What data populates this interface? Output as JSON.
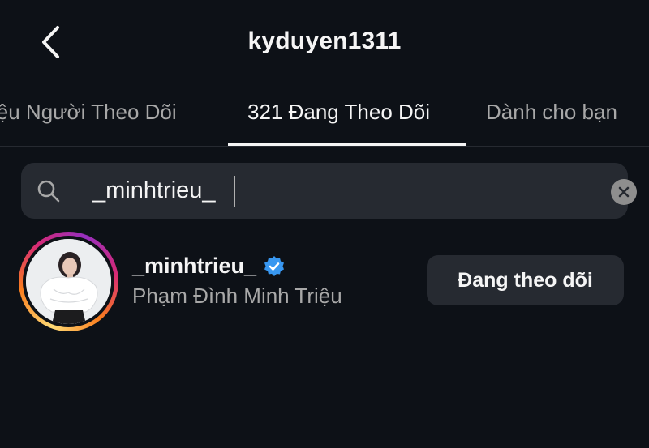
{
  "header": {
    "title": "kyduyen1311",
    "back_icon": "chevron-left-icon"
  },
  "tabs": [
    {
      "label": "iệu Người Theo Dõi",
      "active": false
    },
    {
      "label": "321 Đang Theo Dõi",
      "active": true
    },
    {
      "label": "Dành cho bạn",
      "active": false
    }
  ],
  "search": {
    "value": "_minhtrieu_",
    "icon": "search-icon",
    "clear_icon": "clear-icon"
  },
  "results": [
    {
      "username": "_minhtrieu_",
      "verified": true,
      "full_name": "Phạm Đình Minh Triệu",
      "follow_button_label": "Đang theo dõi",
      "has_story_ring": true
    }
  ],
  "colors": {
    "background": "#0d1117",
    "surface": "#262a31",
    "text_primary": "#f5f5f5",
    "text_secondary": "#a8a8a8",
    "verified_blue": "#3897f0"
  }
}
